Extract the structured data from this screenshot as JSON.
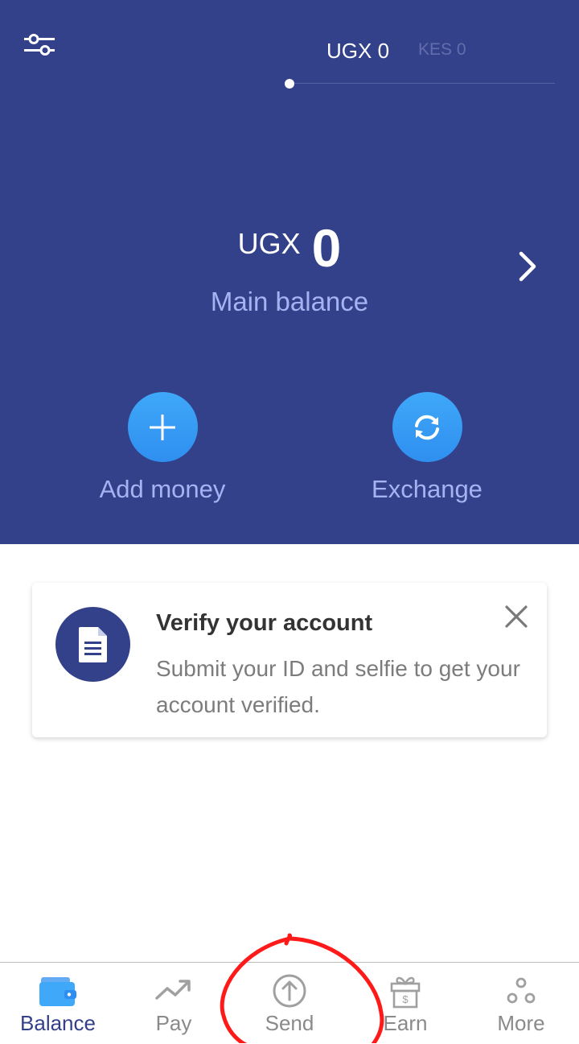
{
  "colors": {
    "header_bg": "#33418a",
    "accent_blue": "#3fa8f8",
    "caption_text": "#a6b3f2",
    "nav_active": "#33418a",
    "annotation_red": "#ff1a1a"
  },
  "header": {
    "settings_icon": "sliders-icon",
    "currency_tabs": [
      {
        "label": "UGX 0",
        "active": true
      },
      {
        "label": "KES 0",
        "active": false
      }
    ]
  },
  "balance": {
    "currency": "UGX",
    "amount": "0",
    "caption": "Main balance",
    "chevron_icon": "chevron-right-icon"
  },
  "actions": [
    {
      "label": "Add money",
      "icon": "plus-icon"
    },
    {
      "label": "Exchange",
      "icon": "refresh-icon"
    }
  ],
  "verify_card": {
    "icon": "document-icon",
    "title": "Verify your account",
    "body": "Submit your ID and selfie to get your account verified.",
    "close_icon": "close-icon"
  },
  "bottom_nav": [
    {
      "label": "Balance",
      "icon": "wallet-icon",
      "active": true
    },
    {
      "label": "Pay",
      "icon": "trend-up-icon",
      "active": false
    },
    {
      "label": "Send",
      "icon": "upload-circle-icon",
      "active": false
    },
    {
      "label": "Earn",
      "icon": "gift-icon",
      "active": false
    },
    {
      "label": "More",
      "icon": "dots-icon",
      "active": false
    }
  ]
}
